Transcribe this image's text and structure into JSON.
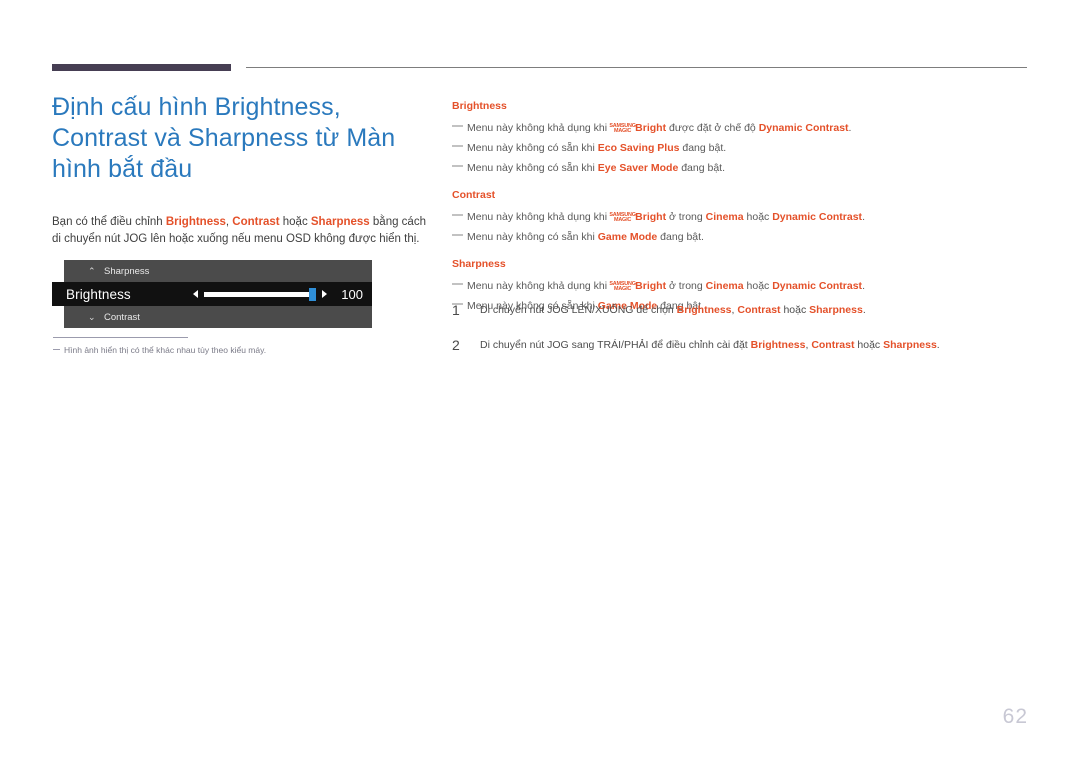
{
  "decor": {
    "rule_thick_color": "#463e53",
    "rule_thin_color": "#7d7d7d",
    "accent_color": "#e4512a",
    "heading_color": "#2a79bd"
  },
  "heading": {
    "line1": "Định cấu hình Brightness,",
    "line2": "Contrast và Sharpness từ Màn",
    "line3": "hình bắt đầu"
  },
  "intro": {
    "t1": "Bạn có thể điều chỉnh ",
    "k1": "Brightness",
    "t2": ", ",
    "k2": "Contrast",
    "t3": " hoặc ",
    "k3": "Sharpness",
    "t4": " bằng cách di chuyển nút JOG lên hoặc xuống nếu menu OSD không được hiển thị."
  },
  "osd": {
    "top_item": "Sharpness",
    "top_icon": "chevron-up",
    "top_icon_glyph": "⌃",
    "active_item": "Brightness",
    "value": "100",
    "bottom_item": "Contrast",
    "bottom_icon": "chevron-down",
    "bottom_icon_glyph": "⌄",
    "handle_color": "#2f8fd8",
    "panel_color": "#4b4b4b",
    "active_row_color": "#111111"
  },
  "footnote": {
    "text": "Hình ảnh hiển thị có thể khác nhau tùy theo kiểu máy."
  },
  "notes": {
    "magic_top": "SAMSUNG",
    "magic_bottom": "MAGIC",
    "groups": [
      {
        "title": "Brightness",
        "lines": [
          {
            "pre": "Menu này không khả dụng khi ",
            "magic": true,
            "bright": "Bright",
            "mid": " được đặt ở chế độ ",
            "kw": "Dynamic Contrast",
            "post": "."
          },
          {
            "pre": "Menu này không có sẵn khi ",
            "magic": false,
            "bright": "",
            "mid": "",
            "kw": "Eco Saving Plus",
            "post": " đang bật."
          },
          {
            "pre": "Menu này không có sẵn khi ",
            "magic": false,
            "bright": "",
            "mid": "",
            "kw": "Eye Saver Mode",
            "post": " đang bật."
          }
        ]
      },
      {
        "title": "Contrast",
        "lines": [
          {
            "pre": "Menu này không khả dụng khi ",
            "magic": true,
            "bright": "Bright",
            "mid": " ở trong ",
            "kw": "Cinema",
            "mid2": " hoặc ",
            "kw2": "Dynamic Contrast",
            "post": "."
          },
          {
            "pre": "Menu này không có sẵn khi ",
            "magic": false,
            "bright": "",
            "mid": "",
            "kw": "Game Mode",
            "post": " đang bật."
          }
        ]
      },
      {
        "title": "Sharpness",
        "lines": [
          {
            "pre": "Menu này không khả dụng khi ",
            "magic": true,
            "bright": "Bright",
            "mid": " ở trong ",
            "kw": "Cinema",
            "mid2": " hoặc ",
            "kw2": "Dynamic Contrast",
            "post": "."
          },
          {
            "pre": "Menu này không có sẵn khi ",
            "magic": false,
            "bright": "",
            "mid": "",
            "kw": "Game Mode",
            "post": " đang bật."
          }
        ]
      }
    ]
  },
  "steps": [
    {
      "num": "1",
      "pre": "Di chuyển nút JOG LÊN/XUỐNG để chọn ",
      "k1": "Brightness",
      "s1": ", ",
      "k2": "Contrast",
      "s2": " hoặc ",
      "k3": "Sharpness",
      "post": "."
    },
    {
      "num": "2",
      "pre": "Di chuyển nút JOG sang TRÁI/PHẢI để điều chỉnh cài đặt ",
      "k1": "Brightness",
      "s1": ", ",
      "k2": "Contrast",
      "s2": " hoặc ",
      "k3": "Sharpness",
      "post": "."
    }
  ],
  "page_number": "62"
}
